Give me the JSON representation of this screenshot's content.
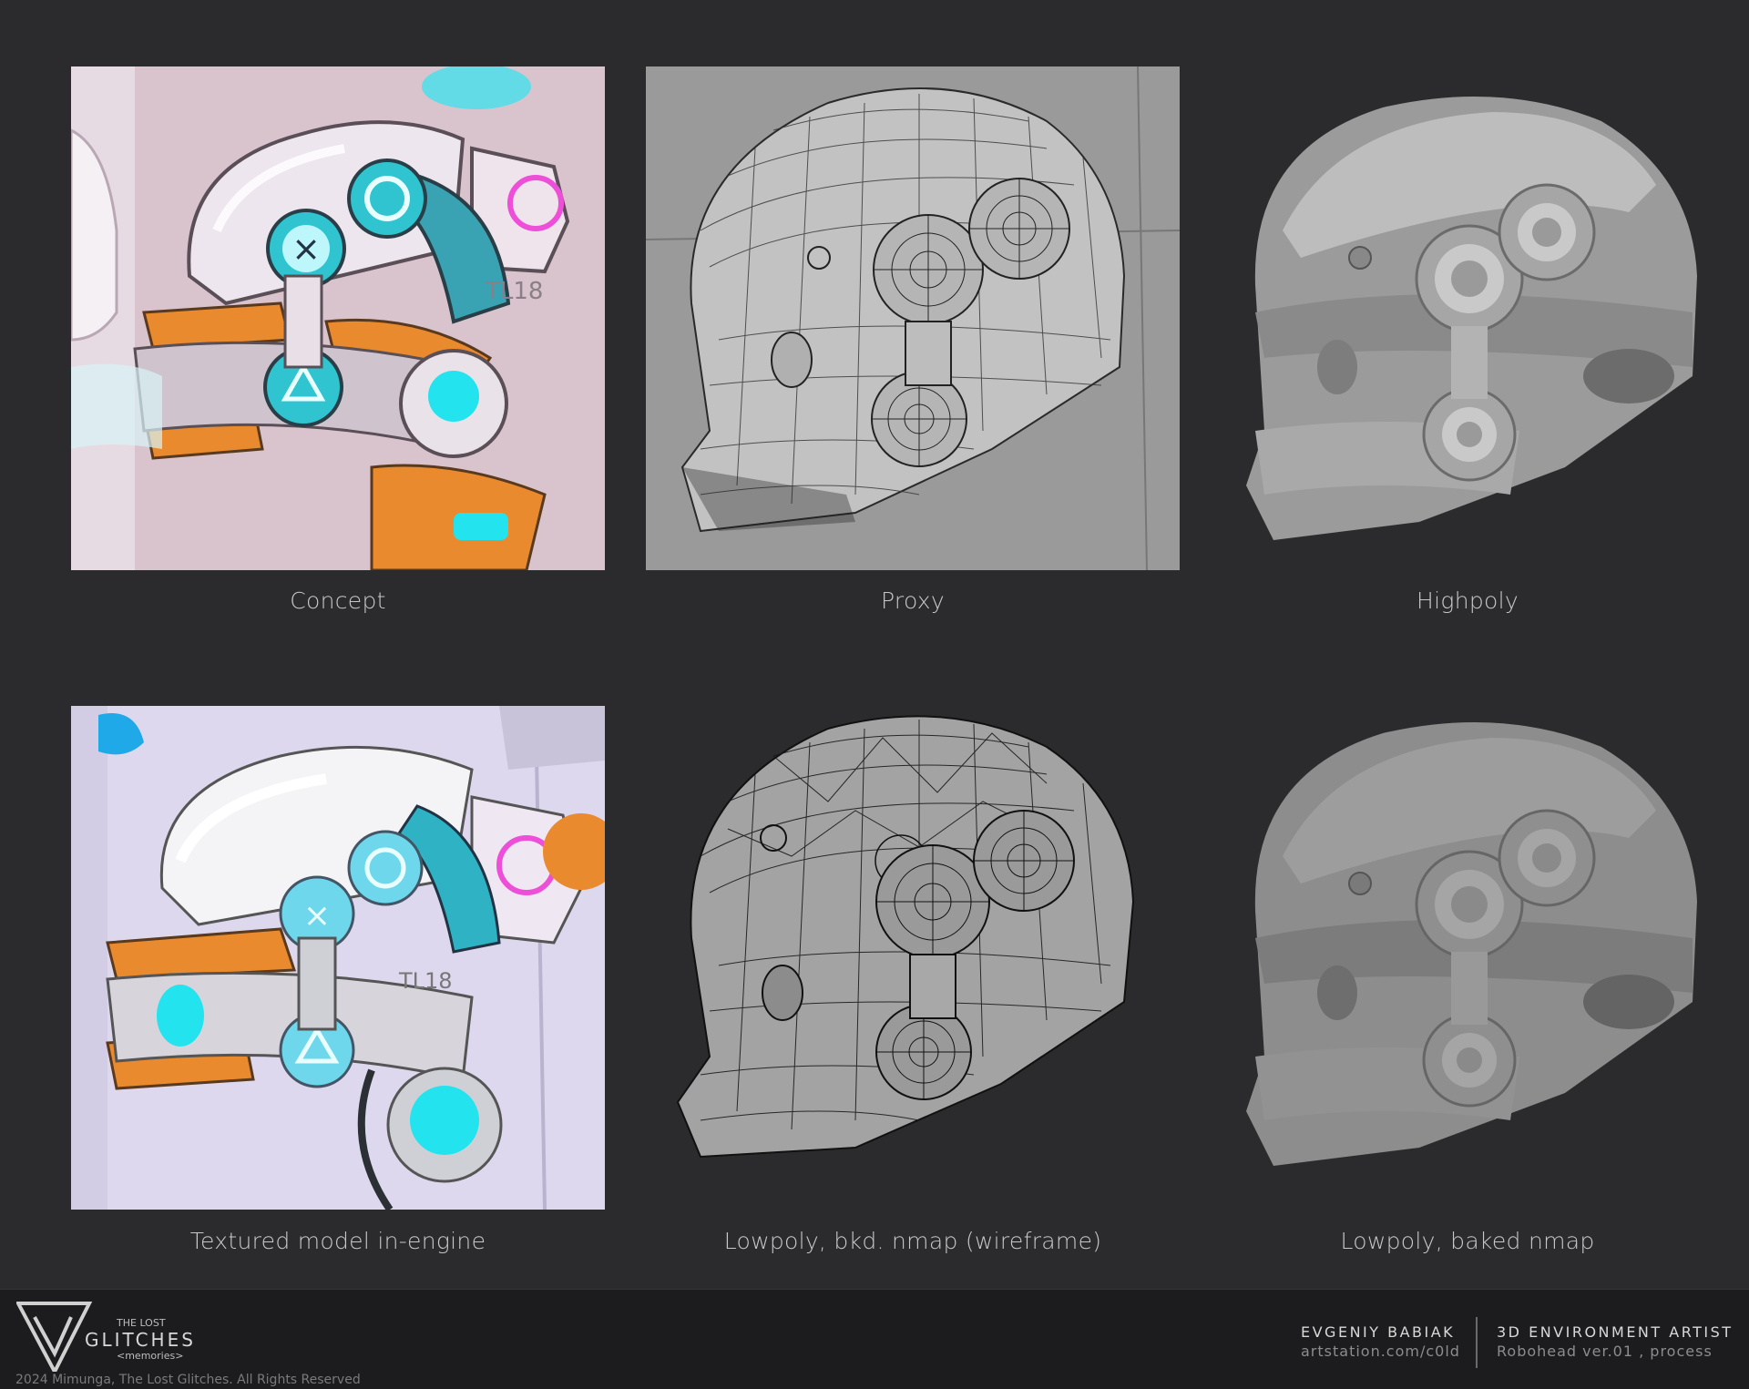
{
  "panels": [
    {
      "id": "concept",
      "caption": "Concept"
    },
    {
      "id": "proxy",
      "caption": "Proxy"
    },
    {
      "id": "highpoly",
      "caption": "Highpoly"
    },
    {
      "id": "textured",
      "caption": "Textured model in-engine"
    },
    {
      "id": "lowpoly-wire",
      "caption": "Lowpoly, bkd. nmap (wireframe)"
    },
    {
      "id": "lowpoly-baked",
      "caption": "Lowpoly, baked nmap"
    }
  ],
  "concept_labels": {
    "tag": "TL18"
  },
  "textured_labels": {
    "tag": "TL18"
  },
  "footer": {
    "logo_top": "THE LOST",
    "logo_main": "GLITCHES",
    "logo_sub": "<memories>",
    "copyright": "2024 Mimunga, The Lost Glitches. All Rights Reserved",
    "author_name": "EVGENIY BABIAK",
    "author_link": "artstation.com/c0ld",
    "role": "3D ENVIRONMENT ARTIST",
    "project": "Robohead ver.01 , process"
  },
  "colors": {
    "background": "#2b2b2d",
    "accent_cyan": "#23e3ef",
    "accent_orange": "#e98a2e",
    "accent_pink": "#ee4fd8"
  }
}
